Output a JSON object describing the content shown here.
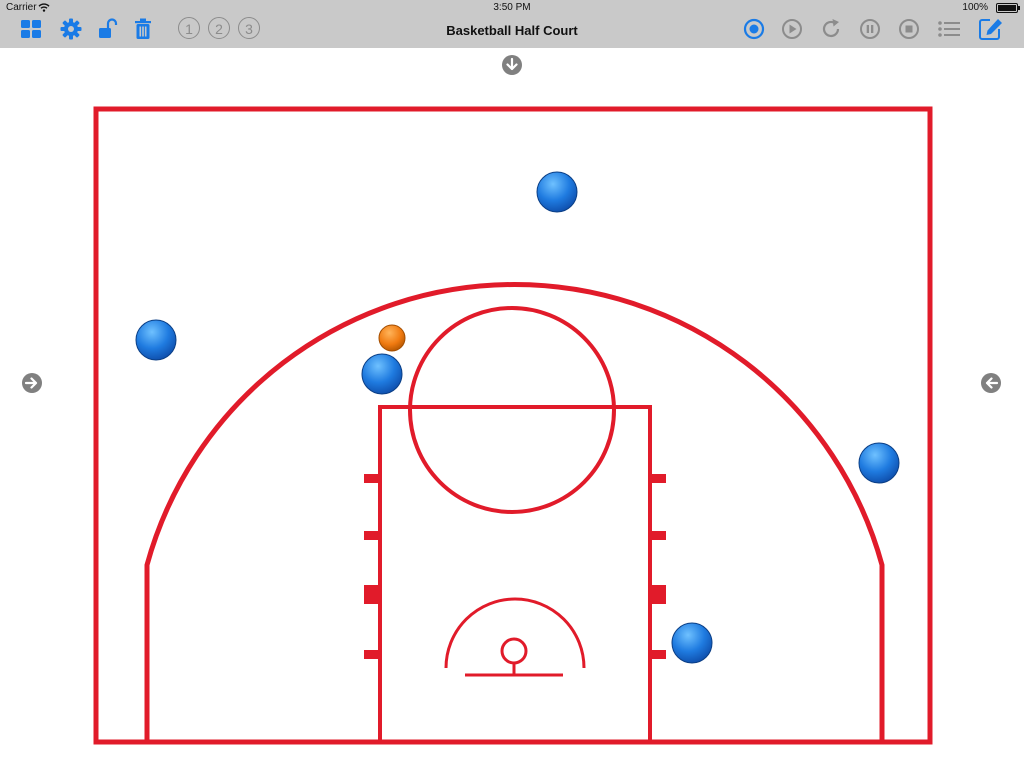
{
  "status_bar": {
    "carrier": "Carrier",
    "time": "3:50 PM",
    "battery": "100%",
    "battery_level": 1.0
  },
  "title": "Basketball Half Court",
  "toolbar": {
    "left_icons": [
      "grid-icon",
      "gear-icon",
      "unlock-icon",
      "trash-icon"
    ],
    "slots": [
      "①",
      "②",
      "③"
    ],
    "right_icons": [
      "record-icon",
      "play-icon",
      "redo-icon",
      "pause-icon",
      "stop-icon",
      "list-icon",
      "edit-icon"
    ]
  },
  "colors": {
    "accent": "#1a7be6",
    "bar_bg": "#c9c9c9",
    "inactive": "#8c8c8c",
    "court_line": "#e11b2a",
    "player": "#1f7be0",
    "ball": "#f07a10"
  },
  "court": {
    "players": [
      "player-1",
      "player-2",
      "player-3",
      "player-4",
      "player-5"
    ],
    "ball": "ball"
  }
}
